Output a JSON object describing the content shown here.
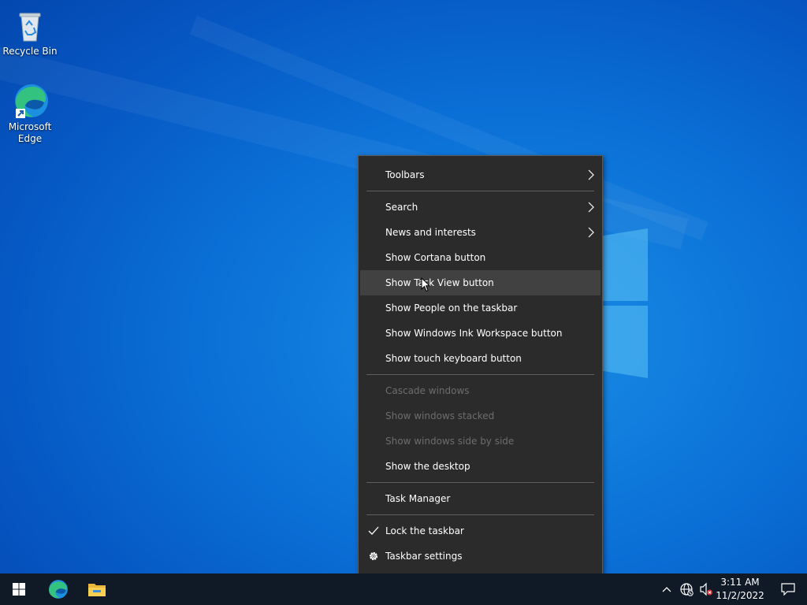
{
  "desktop": {
    "icons": [
      {
        "label": "Recycle Bin",
        "icon": "recycle-bin-icon"
      },
      {
        "label": "Microsoft\nEdge",
        "icon": "edge-icon"
      }
    ]
  },
  "context_menu": {
    "items": [
      {
        "label": "Toolbars",
        "submenu": true,
        "enabled": true
      },
      {
        "label": "Search",
        "submenu": true,
        "enabled": true
      },
      {
        "label": "News and interests",
        "submenu": true,
        "enabled": true
      },
      {
        "label": "Show Cortana button",
        "enabled": true
      },
      {
        "label": "Show Task View button",
        "enabled": true,
        "hovered": true
      },
      {
        "label": "Show People on the taskbar",
        "enabled": true
      },
      {
        "label": "Show Windows Ink Workspace button",
        "enabled": true
      },
      {
        "label": "Show touch keyboard button",
        "enabled": true
      },
      {
        "label": "Cascade windows",
        "enabled": false
      },
      {
        "label": "Show windows stacked",
        "enabled": false
      },
      {
        "label": "Show windows side by side",
        "enabled": false
      },
      {
        "label": "Show the desktop",
        "enabled": true
      },
      {
        "label": "Task Manager",
        "enabled": true
      },
      {
        "label": "Lock the taskbar",
        "enabled": true,
        "checked": true
      },
      {
        "label": "Taskbar settings",
        "enabled": true,
        "icon": "gear-icon"
      }
    ]
  },
  "taskbar": {
    "pinned": [
      {
        "icon": "windows-start-icon"
      },
      {
        "icon": "edge-icon"
      },
      {
        "icon": "file-explorer-icon"
      }
    ],
    "tray": {
      "icons": [
        "chevron-up-icon",
        "network-globe-icon",
        "volume-muted-icon"
      ],
      "time": "3:11 AM",
      "date": "11/2/2022",
      "notification_icon": "notification-icon"
    }
  },
  "colors": {
    "menu_bg": "#2b2b2b",
    "menu_hover": "#414141",
    "menu_disabled_text": "#6d6d6d",
    "taskbar_bg": "#101a27"
  }
}
